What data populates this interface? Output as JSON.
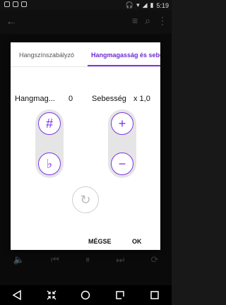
{
  "status": {
    "time": "5:19"
  },
  "dialog": {
    "tabs": [
      {
        "label": "Hangszínszabályzó"
      },
      {
        "label": "Hangmagasság és sebesség"
      }
    ],
    "pitch": {
      "label": "Hangmag...",
      "value": "0",
      "up_symbol": "#",
      "down_symbol": "♭"
    },
    "speed": {
      "label": "Sebesség",
      "value": "x 1,0",
      "up_symbol": "+",
      "down_symbol": "−"
    },
    "reset_symbol": "↻",
    "cancel_label": "MÉGSE",
    "ok_label": "OK"
  },
  "icons": {
    "back": "arrow-left-icon",
    "queue": "playlist-icon",
    "search": "search-icon",
    "more": "more-vert-icon"
  },
  "colors": {
    "accent": "#7b35e8"
  }
}
